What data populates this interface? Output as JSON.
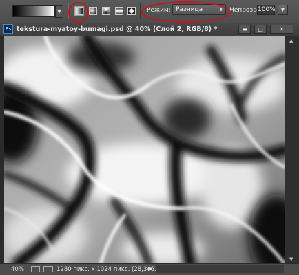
{
  "options_bar": {
    "gradient_picker": "black-to-white",
    "gradient_types": [
      {
        "name": "linear-gradient-icon",
        "selected": true
      },
      {
        "name": "radial-gradient-icon",
        "selected": false
      },
      {
        "name": "angle-gradient-icon",
        "selected": false
      },
      {
        "name": "reflected-gradient-icon",
        "selected": false
      },
      {
        "name": "diamond-gradient-icon",
        "selected": false
      }
    ],
    "mode_label": "Режим:",
    "mode_value": "Разница",
    "opacity_label": "Непрозр.:",
    "opacity_value": "100%",
    "highlight_color": "#c8141a"
  },
  "document": {
    "app_badge": "Ps",
    "title": "tekstura-myatoy-bumagi.psd @ 40% (Слой 2, RGB/8) *",
    "window_buttons": {
      "minimize": "▬",
      "maximize": "□",
      "close": "✕"
    }
  },
  "status_bar": {
    "zoom": "40%",
    "info": "1280 пикс. x 1024 пикс. (28,346...",
    "arrow": "▶"
  }
}
